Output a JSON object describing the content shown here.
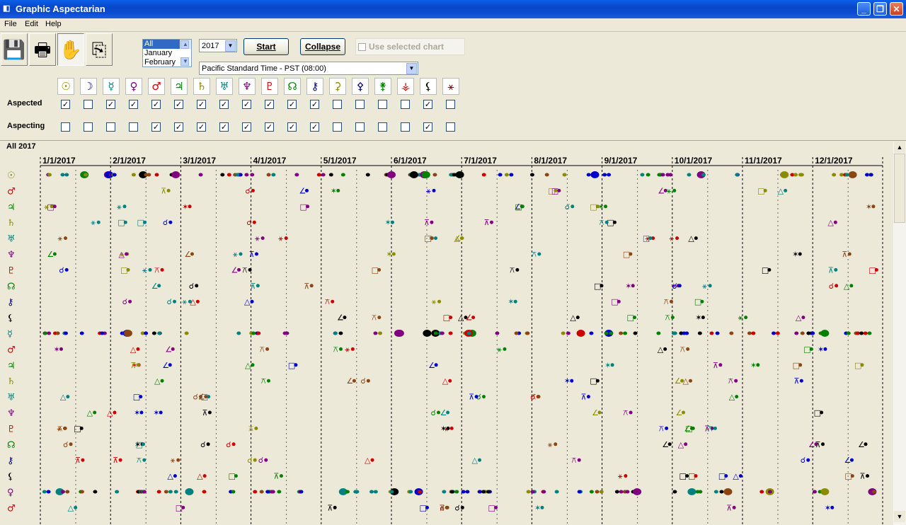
{
  "window": {
    "title": "Graphic Aspectarian"
  },
  "menu": [
    "File",
    "Edit",
    "Help"
  ],
  "toolbar": {
    "icons": [
      "save-icon",
      "print-icon",
      "hand-icon",
      "copy-icon"
    ]
  },
  "months_list": {
    "items": [
      "All",
      "January",
      "February"
    ],
    "selected": "All"
  },
  "year": {
    "value": "2017"
  },
  "buttons": {
    "start": "Start",
    "collapse": "Collapse"
  },
  "use_selected_chart": {
    "label": "Use selected chart",
    "checked": false,
    "enabled": false
  },
  "timezone": {
    "value": "Pacific Standard Time - PST (08:00)"
  },
  "planets": [
    {
      "glyph": "☉",
      "name": "sun",
      "color": "#8b8b00",
      "aspected": true,
      "aspecting": false
    },
    {
      "glyph": "☽",
      "name": "moon",
      "color": "#000080",
      "aspected": false,
      "aspecting": false
    },
    {
      "glyph": "☿",
      "name": "mercury",
      "color": "#008080",
      "aspected": true,
      "aspecting": false
    },
    {
      "glyph": "♀",
      "name": "venus",
      "color": "#800080",
      "aspected": true,
      "aspecting": false
    },
    {
      "glyph": "♂",
      "name": "mars",
      "color": "#cc0000",
      "aspected": true,
      "aspecting": true
    },
    {
      "glyph": "♃",
      "name": "jupiter",
      "color": "#008000",
      "aspected": true,
      "aspecting": true
    },
    {
      "glyph": "♄",
      "name": "saturn",
      "color": "#8b8b00",
      "aspected": true,
      "aspecting": true
    },
    {
      "glyph": "♅",
      "name": "uranus",
      "color": "#008080",
      "aspected": true,
      "aspecting": true
    },
    {
      "glyph": "♆",
      "name": "neptune",
      "color": "#800080",
      "aspected": true,
      "aspecting": true
    },
    {
      "glyph": "♇",
      "name": "pluto",
      "color": "#cc0000",
      "aspected": true,
      "aspecting": true
    },
    {
      "glyph": "☊",
      "name": "node",
      "color": "#008000",
      "aspected": true,
      "aspecting": true
    },
    {
      "glyph": "⚷",
      "name": "chiron",
      "color": "#000080",
      "aspected": true,
      "aspecting": true
    },
    {
      "glyph": "⚳",
      "name": "ceres",
      "color": "#8b8b00",
      "aspected": false,
      "aspecting": false
    },
    {
      "glyph": "⚴",
      "name": "pallas",
      "color": "#000080",
      "aspected": false,
      "aspecting": false
    },
    {
      "glyph": "⚵",
      "name": "juno",
      "color": "#008000",
      "aspected": false,
      "aspecting": false
    },
    {
      "glyph": "⚶",
      "name": "vesta",
      "color": "#cc0000",
      "aspected": false,
      "aspecting": false
    },
    {
      "glyph": "⚸",
      "name": "lilith",
      "color": "#000000",
      "aspected": true,
      "aspecting": true
    },
    {
      "glyph": "⚹",
      "name": "vertex",
      "color": "#800000",
      "aspected": false,
      "aspecting": false
    }
  ],
  "labels": {
    "aspected": "Aspected",
    "aspecting": "Aspecting",
    "chart_title": "All 2017"
  },
  "months_axis": [
    "1/1/2017",
    "2/1/2017",
    "3/1/2017",
    "4/1/2017",
    "5/1/2017",
    "6/1/2017",
    "7/1/2017",
    "8/1/2017",
    "9/1/2017",
    "10/1/2017",
    "11/1/2017",
    "12/1/2017"
  ],
  "chart_rows": [
    {
      "glyph": "☉",
      "color": "#8b8b00",
      "kind": "main"
    },
    {
      "glyph": "♂",
      "color": "#cc0000",
      "kind": "sub"
    },
    {
      "glyph": "♃",
      "color": "#008000",
      "kind": "sub"
    },
    {
      "glyph": "♄",
      "color": "#8b8b00",
      "kind": "sub"
    },
    {
      "glyph": "♅",
      "color": "#008080",
      "kind": "sub"
    },
    {
      "glyph": "♆",
      "color": "#800080",
      "kind": "sub"
    },
    {
      "glyph": "♇",
      "color": "#cc0000",
      "kind": "sub"
    },
    {
      "glyph": "☊",
      "color": "#008000",
      "kind": "sub"
    },
    {
      "glyph": "⚷",
      "color": "#000080",
      "kind": "sub"
    },
    {
      "glyph": "⚸",
      "color": "#000000",
      "kind": "sub"
    },
    {
      "glyph": "☿",
      "color": "#008080",
      "kind": "main"
    },
    {
      "glyph": "♂",
      "color": "#cc0000",
      "kind": "sub"
    },
    {
      "glyph": "♃",
      "color": "#008000",
      "kind": "sub"
    },
    {
      "glyph": "♄",
      "color": "#8b8b00",
      "kind": "sub"
    },
    {
      "glyph": "♅",
      "color": "#008080",
      "kind": "sub"
    },
    {
      "glyph": "♆",
      "color": "#800080",
      "kind": "sub"
    },
    {
      "glyph": "♇",
      "color": "#cc0000",
      "kind": "sub"
    },
    {
      "glyph": "☊",
      "color": "#008000",
      "kind": "sub"
    },
    {
      "glyph": "⚷",
      "color": "#000080",
      "kind": "sub"
    },
    {
      "glyph": "⚸",
      "color": "#000000",
      "kind": "sub"
    },
    {
      "glyph": "♀",
      "color": "#800080",
      "kind": "main"
    },
    {
      "glyph": "♂",
      "color": "#cc0000",
      "kind": "sub"
    }
  ]
}
